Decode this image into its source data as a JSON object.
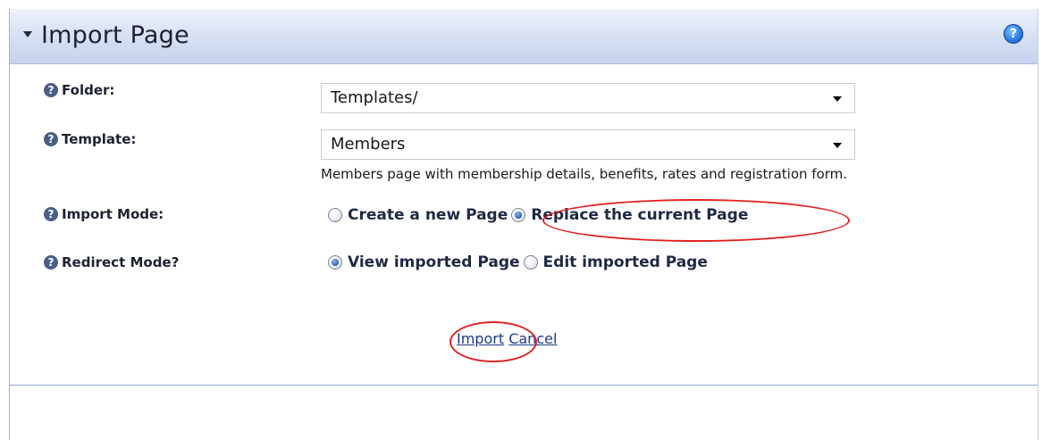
{
  "panel": {
    "title": "Import Page",
    "help_glyph": "?"
  },
  "form": {
    "folder": {
      "label": "Folder:",
      "value": "Templates/"
    },
    "template": {
      "label": "Template:",
      "value": "Members",
      "description": "Members page with membership details, benefits, rates and registration form."
    },
    "import_mode": {
      "label": "Import Mode:",
      "options": [
        {
          "label": "Create a new Page",
          "checked": false
        },
        {
          "label": "Replace the current Page",
          "checked": true
        }
      ]
    },
    "redirect_mode": {
      "label": "Redirect Mode?",
      "options": [
        {
          "label": "View imported Page",
          "checked": true
        },
        {
          "label": "Edit imported Page",
          "checked": false
        }
      ]
    }
  },
  "actions": {
    "import_label": "Import",
    "cancel_label": "Cancel"
  },
  "icons": {
    "collapse": "triangle-down-icon",
    "help": "question-circle-icon"
  },
  "colors": {
    "header_gradient_top": "#eef2fb",
    "header_gradient_bottom": "#c5d2ec",
    "link": "#1a3a8c",
    "annotation": "#e02222"
  }
}
